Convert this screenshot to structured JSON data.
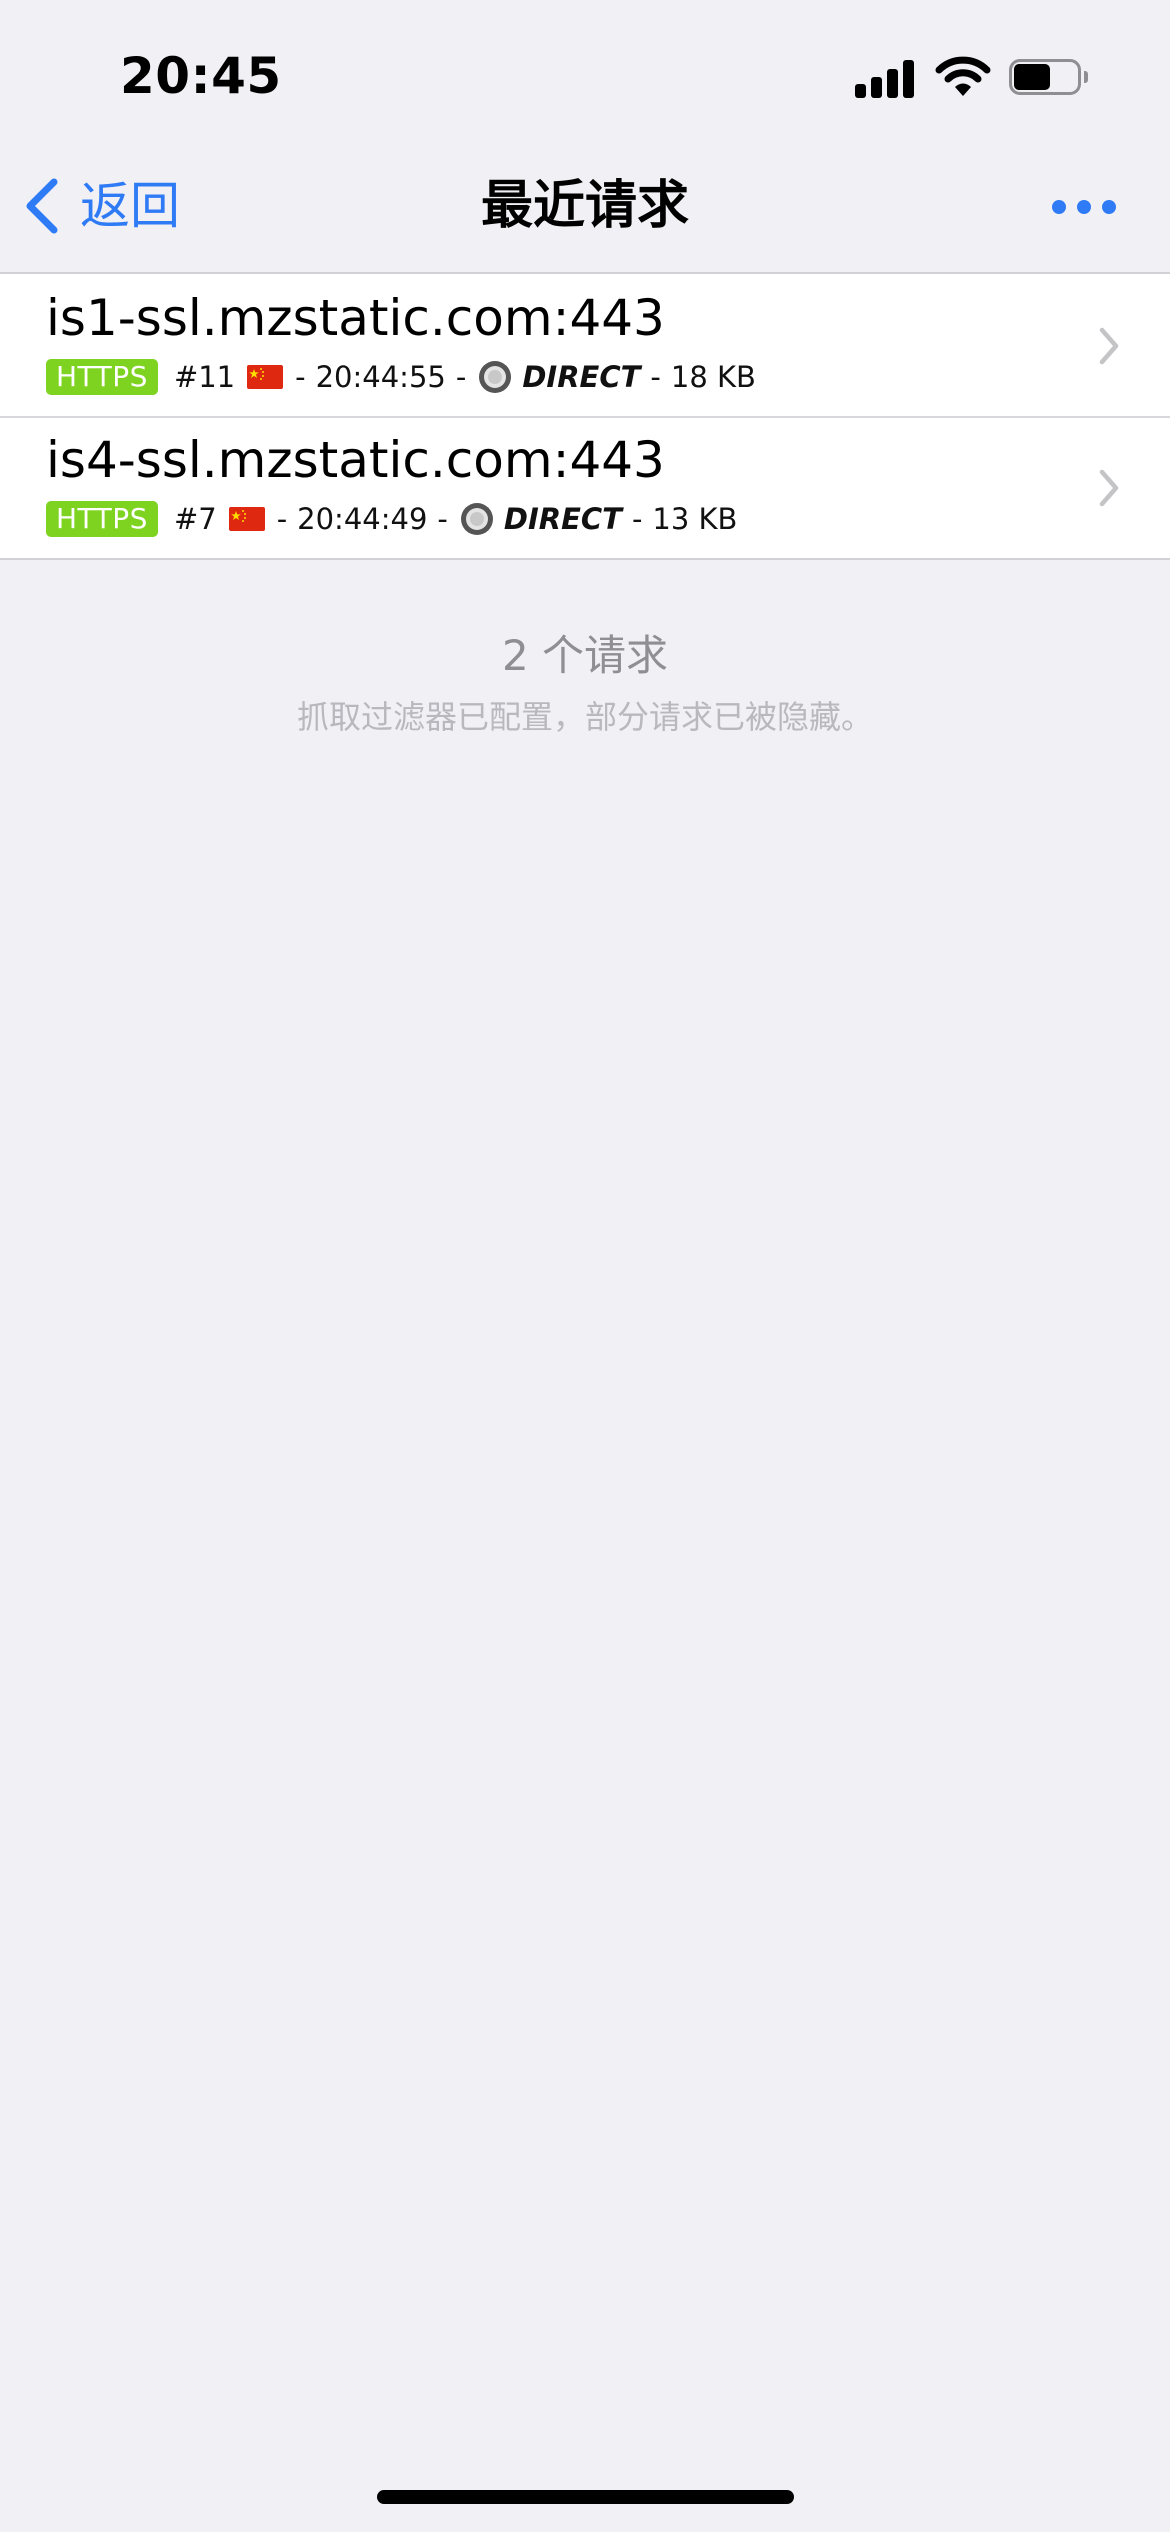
{
  "status_bar": {
    "time": "20:45"
  },
  "nav": {
    "back_label": "返回",
    "title": "最近请求"
  },
  "requests": [
    {
      "host": "is1-ssl.mzstatic.com:443",
      "protocol": "HTTPS",
      "id": "#11",
      "sep1": "-",
      "time": "20:44:55",
      "sep2": "-",
      "policy": "DIRECT",
      "sep3": "-",
      "size": "18 KB"
    },
    {
      "host": "is4-ssl.mzstatic.com:443",
      "protocol": "HTTPS",
      "id": "#7",
      "sep1": "-",
      "time": "20:44:49",
      "sep2": "-",
      "policy": "DIRECT",
      "sep3": "-",
      "size": "13 KB"
    }
  ],
  "footer": {
    "count": "2 个请求",
    "note": "抓取过滤器已配置，部分请求已被隐藏。"
  },
  "icons": {
    "back": "chevron-left-icon",
    "more": "ellipsis-icon",
    "flag": "china-flag-icon",
    "policy": "direct-policy-icon",
    "row": "chevron-right-icon"
  },
  "colors": {
    "accent": "#2f7bf5",
    "https_badge": "#7ed321",
    "background": "#f0f0f5"
  }
}
